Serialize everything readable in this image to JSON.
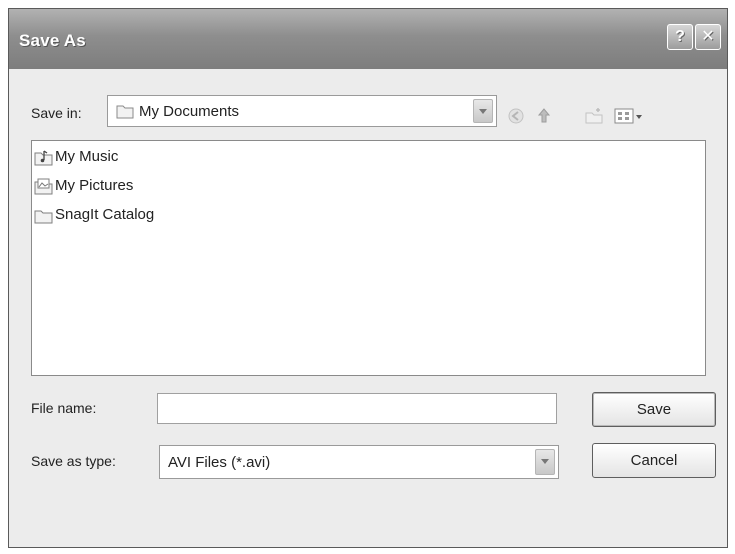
{
  "dialog": {
    "title": "Save As",
    "help_glyph": "?",
    "close_glyph": "✕"
  },
  "save_in": {
    "label": "Save in:",
    "value": "My Documents",
    "icon": "folder-icon"
  },
  "toolbar": {
    "items": [
      "back-icon",
      "up-folder-icon",
      "new-folder-icon",
      "views-menu-icon"
    ]
  },
  "files": [
    {
      "name": "My Music",
      "icon": "music-folder-icon"
    },
    {
      "name": "My Pictures",
      "icon": "pictures-folder-icon"
    },
    {
      "name": "SnagIt Catalog",
      "icon": "folder-icon"
    }
  ],
  "file_name": {
    "label": "File name:",
    "value": ""
  },
  "save_as_type": {
    "label": "Save as type:",
    "value": "AVI Files (*.avi)"
  },
  "buttons": {
    "save": "Save",
    "cancel": "Cancel"
  },
  "colors": {
    "titlebar": "#8e8e8e",
    "dialog_bg": "#ececec"
  }
}
